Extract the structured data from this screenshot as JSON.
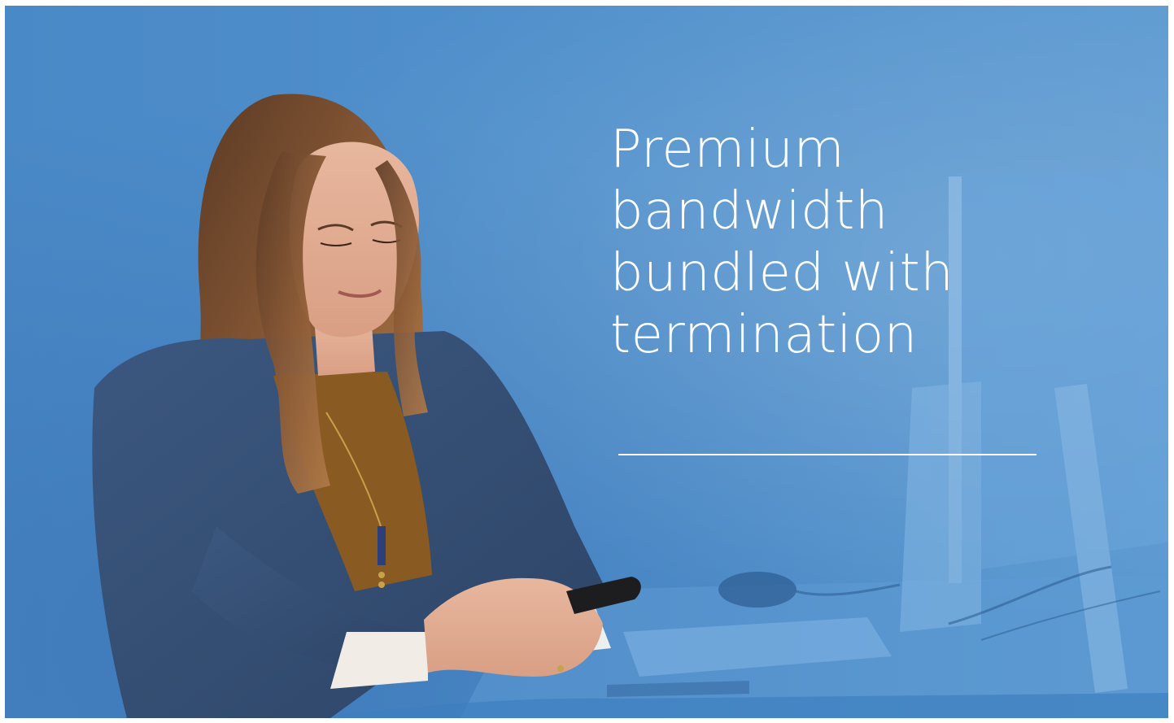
{
  "hero": {
    "headline_lines": [
      "Premium",
      "bandwidth",
      "bundled with",
      "termination"
    ],
    "background_color": "#4f8fcb",
    "text_color": "#ffffff"
  }
}
